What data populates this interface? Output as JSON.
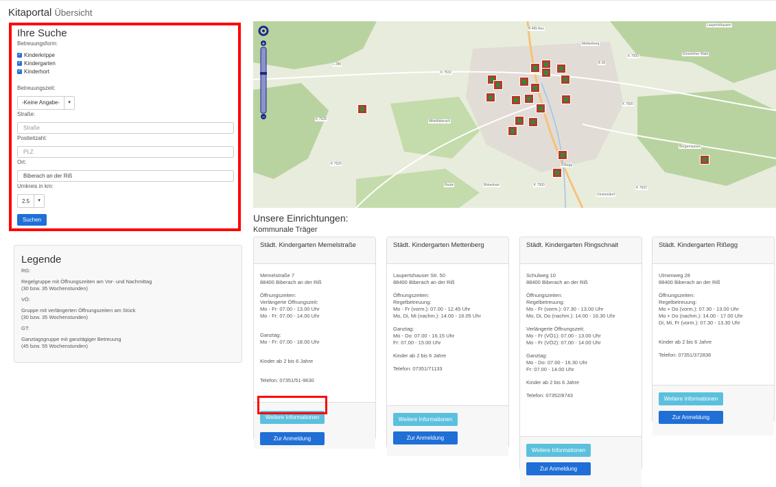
{
  "app": {
    "title": "Kitaportal",
    "subtitle": "Übersicht"
  },
  "search": {
    "heading": "Ihre Suche",
    "betreuungsform_label": "Betreuungsform:",
    "options": [
      "Kinderkrippe",
      "Kindergarten",
      "Kinderhort"
    ],
    "betreuungszeit_label": "Betreuungszeit:",
    "betreuungszeit_value": "-Keine Angabe-",
    "strasse_label": "Straße:",
    "strasse_placeholder": "Straße",
    "plz_label": "Postleitzahl:",
    "plz_placeholder": "PLZ",
    "ort_label": "Ort:",
    "ort_value": "Biberach an der Riß",
    "umkreis_label": "Umkreis in km:",
    "umkreis_value": "2.5",
    "submit": "Suchen"
  },
  "legend": {
    "heading": "Legende",
    "items": [
      {
        "code": "RG:",
        "text": "Regelgruppe mit Öffnungszeiten am Vor- und Nachmittag",
        "hours": "(30 bzw. 35 Wochenstunden)"
      },
      {
        "code": "VÖ:",
        "text": "Gruppe mit verlängerten Öffnungszeiten am Stück",
        "hours": "(30 bzw. 35 Wochenstunden)"
      },
      {
        "code": "GT:",
        "text": "Ganztagsgruppe mit ganztägiger Betreuung",
        "hours": "(45 bzw. 55 Wochenstunden)"
      }
    ]
  },
  "map": {
    "labels": [
      "B 465 Aus",
      "Mettenberg",
      "Ehrenloher Wald",
      "K 7500",
      "L 280",
      "B 30",
      "K 7532",
      "K 7500",
      "Mittelbiberach",
      "K 7528",
      "K 7529",
      "Reute",
      "Birkenhart",
      "Rißegg",
      "K 7500",
      "K 7502",
      "Bergerhausen",
      "Laupertshausen",
      "Ummendorf"
    ]
  },
  "facilities": {
    "heading": "Unsere Einrichtungen:",
    "group": "Kommunale Träger",
    "info_label": "Weitere Informationen",
    "register_label": "Zur Anmeldung",
    "cards": [
      {
        "name": "Städt. Kindergarten Memelstraße",
        "street": "Memelstraße 7",
        "city": "88400 Biberach an der Riß",
        "hours_title": "Öffnungszeiten:",
        "lines1": [
          "Verlängerte Öffnungszeit:",
          "Mo - Fr: 07.00 - 13.00 Uhr",
          "Mo - Fr: 07.00 - 14.00 Uhr"
        ],
        "lines2": [
          "Ganztag:",
          "Mo - Fr: 07.00 - 18.00 Uhr"
        ],
        "lines3": [],
        "age": "Kinder ab 2 bis 6 Jahre",
        "phone": "Telefon: 07351/51-9630"
      },
      {
        "name": "Städt. Kindergarten Mettenberg",
        "street": "Laupertshauser Str. 50",
        "city": "88400 Biberach an der Riß",
        "hours_title": "Öffnungszeiten:",
        "lines1": [
          "Regelbetreuung:",
          "Mo - Fr (vorm.): 07.00 - 12.45 Uhr",
          "Mo, Di, Mi (nachm.): 14.00 - 16.05 Uhr"
        ],
        "lines2": [
          "Ganztag:",
          "Mo - Do: 07.00 - 16.15 Uhr",
          "Fr: 07.00 - 15.00 Uhr"
        ],
        "lines3": [],
        "age": "Kinder ab 2 bis 6 Jahre",
        "phone": "Telefon: 07351/71133"
      },
      {
        "name": "Städt. Kindergarten Ringschnait",
        "street": "Schulweg 10",
        "city": "88400 Biberach an der Riß",
        "hours_title": "Öffnungszeiten:",
        "lines1": [
          "Regelbetreuung:",
          "Mo - Fr (vorm.): 07.30 - 13.00 Uhr",
          "Mo, Di, Do (nachm.): 14.00 - 16.30 Uhr"
        ],
        "lines2": [
          "Verlängerte Öffnungszeit:",
          "Mo - Fr (VÖ1): 07.00 - 13.00 Uhr",
          "Mo - Fr (VÖ2): 07.00 - 14.00 Uhr"
        ],
        "lines3": [
          "Ganztag:",
          "Mo - Do: 07.00 - 16.30 Uhr",
          "Fr: 07.00 - 14.00 Uhr"
        ],
        "age": "Kinder ab 2 bis 6 Jahre",
        "phone": "Telefon: 07352/8743"
      },
      {
        "name": "Städt. Kindergarten Rißegg",
        "street": "Ulmenweg 28",
        "city": "88400 Biberach an der Riß",
        "hours_title": "Öffnungszeiten:",
        "lines1": [
          "Regelbetreuung:",
          "Mo + Do (vorm.): 07.30 - 13.00 Uhr",
          "Mo + Do (nachm.): 14.00 - 17.00 Uhr",
          "Di, Mi, Fr (vorm.): 07.30 - 13.30 Uhr"
        ],
        "lines2": [],
        "lines3": [],
        "age": "Kinder ab 2 bis 6 Jahre",
        "phone": "Telefon: 07351/372836"
      }
    ]
  }
}
